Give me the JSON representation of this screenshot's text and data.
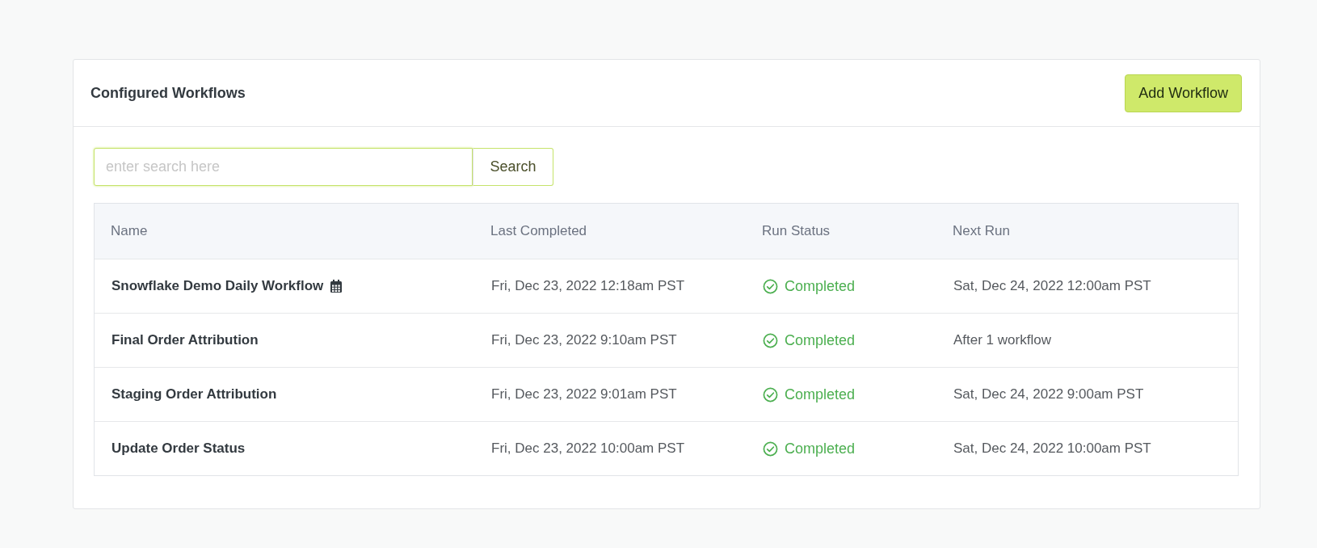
{
  "panel": {
    "title": "Configured Workflows",
    "add_button": "Add Workflow"
  },
  "search": {
    "placeholder": "enter search here",
    "button": "Search"
  },
  "table": {
    "columns": [
      "Name",
      "Last Completed",
      "Run Status",
      "Next Run"
    ],
    "rows": [
      {
        "name": "Snowflake Demo Daily Workflow",
        "scheduled": true,
        "last_completed": "Fri, Dec 23, 2022 12:18am PST",
        "status": {
          "kind": "completed",
          "label": "Completed"
        },
        "next_run": "Sat, Dec 24, 2022 12:00am PST"
      },
      {
        "name": "Final Order Attribution",
        "scheduled": false,
        "last_completed": "Fri, Dec 23, 2022 9:10am PST",
        "status": {
          "kind": "completed",
          "label": "Completed"
        },
        "next_run": "After 1 workflow"
      },
      {
        "name": "Staging Order Attribution",
        "scheduled": false,
        "last_completed": "Fri, Dec 23, 2022 9:01am PST",
        "status": {
          "kind": "completed",
          "label": "Completed"
        },
        "next_run": "Sat, Dec 24, 2022 9:00am PST"
      },
      {
        "name": "Update Order Status",
        "scheduled": false,
        "last_completed": "Fri, Dec 23, 2022 10:00am PST",
        "status": {
          "kind": "completed",
          "label": "Completed"
        },
        "next_run": "Sat, Dec 24, 2022 10:00am PST"
      }
    ]
  }
}
